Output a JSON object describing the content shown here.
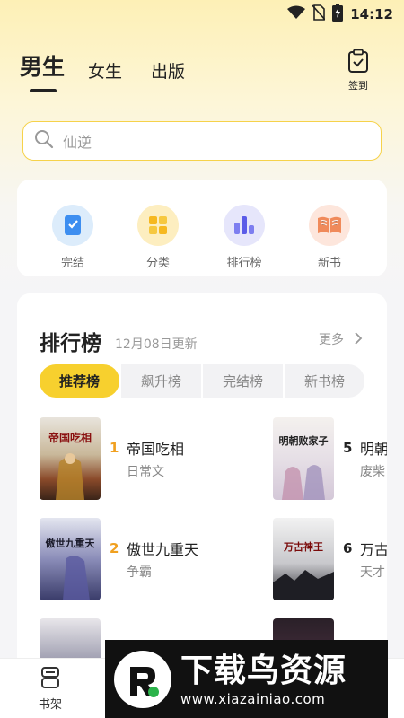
{
  "status_bar": {
    "time": "14:12"
  },
  "header": {
    "tabs": [
      {
        "label": "男生",
        "active": true
      },
      {
        "label": "女生",
        "active": false
      },
      {
        "label": "出版",
        "active": false
      }
    ],
    "checkin_label": "签到"
  },
  "search": {
    "placeholder": "仙逆"
  },
  "quick_links": [
    {
      "label": "完结",
      "icon": "book-check-icon"
    },
    {
      "label": "分类",
      "icon": "category-grid-icon"
    },
    {
      "label": "排行榜",
      "icon": "ranking-bars-icon"
    },
    {
      "label": "新书",
      "icon": "open-book-icon"
    }
  ],
  "ranking": {
    "title": "排行榜",
    "updated": "12月08日更新",
    "more_label": "更多",
    "tabs": [
      "推荐榜",
      "飙升榜",
      "完结榜",
      "新书榜"
    ],
    "active_tab": "推荐榜",
    "books": [
      {
        "rank": "1",
        "title": "帝国吃相",
        "author": "日常文",
        "cover_text": "帝国吃相"
      },
      {
        "rank": "5",
        "title": "明朝",
        "author": "废柴",
        "cover_text": "明朝败家子"
      },
      {
        "rank": "2",
        "title": "傲世九重天",
        "author": "争霸",
        "cover_text": "傲世九重天"
      },
      {
        "rank": "6",
        "title": "万古",
        "author": "天才",
        "cover_text": "万古神王"
      }
    ]
  },
  "bottom_nav": {
    "bookshelf_label": "书架"
  },
  "watermark": {
    "brand": "下载鸟资源",
    "url": "www.xiazainiao.com"
  },
  "colors": {
    "accent": "#f7d02e",
    "rank_number": "#f0a020"
  }
}
